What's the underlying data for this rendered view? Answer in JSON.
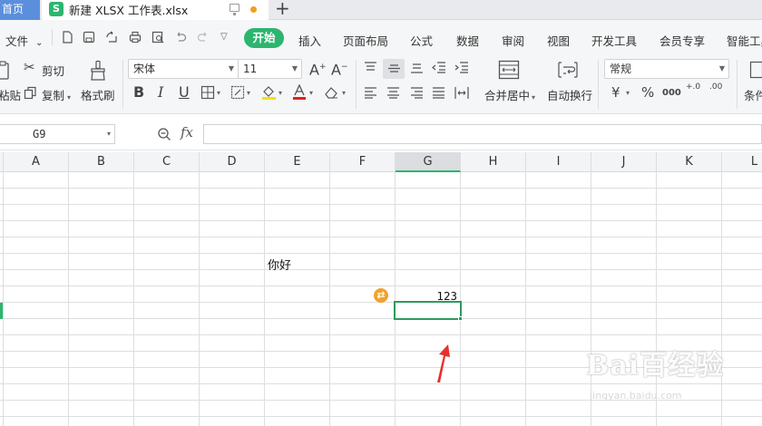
{
  "tabs": {
    "home_label": "首页",
    "doc_icon": "S",
    "doc_title": "新建 XLSX 工作表.xlsx",
    "add_label": "+"
  },
  "menu": {
    "file_label": "文件",
    "start_label": "开始",
    "items": [
      "插入",
      "页面布局",
      "公式",
      "数据",
      "审阅",
      "视图",
      "开发工具",
      "会员专享",
      "智能工具"
    ]
  },
  "ribbon": {
    "cut_label": "剪切",
    "copy_label": "复制",
    "paste_label": "粘贴",
    "format_painter_label": "格式刷",
    "font_name": "宋体",
    "font_size": "11",
    "bold": "B",
    "italic": "I",
    "underline": "U",
    "merge_label": "合并居中",
    "wrap_label": "自动换行",
    "number_format": "常规",
    "currency_symbol": "¥",
    "percent_symbol": "%",
    "thousands_symbol": "000",
    "inc_decimal": "+.0",
    "dec_decimal": ".00",
    "conditional_label": "条件"
  },
  "formula_bar": {
    "cell_ref": "G9",
    "fx_label": "fx",
    "formula_value": ""
  },
  "columns": [
    "A",
    "B",
    "C",
    "D",
    "E",
    "F",
    "G",
    "H",
    "I",
    "J",
    "K",
    "L"
  ],
  "selected_column": "G",
  "cells": {
    "E6": "你好",
    "G8": "123"
  },
  "watermark": {
    "brand": "Bai百经验",
    "url": "jingyan.baidu.com"
  },
  "colors": {
    "accent": "#2db56f",
    "selection_border": "#2d9a5c",
    "badge": "#f0a22e",
    "arrow": "#e8302a"
  }
}
